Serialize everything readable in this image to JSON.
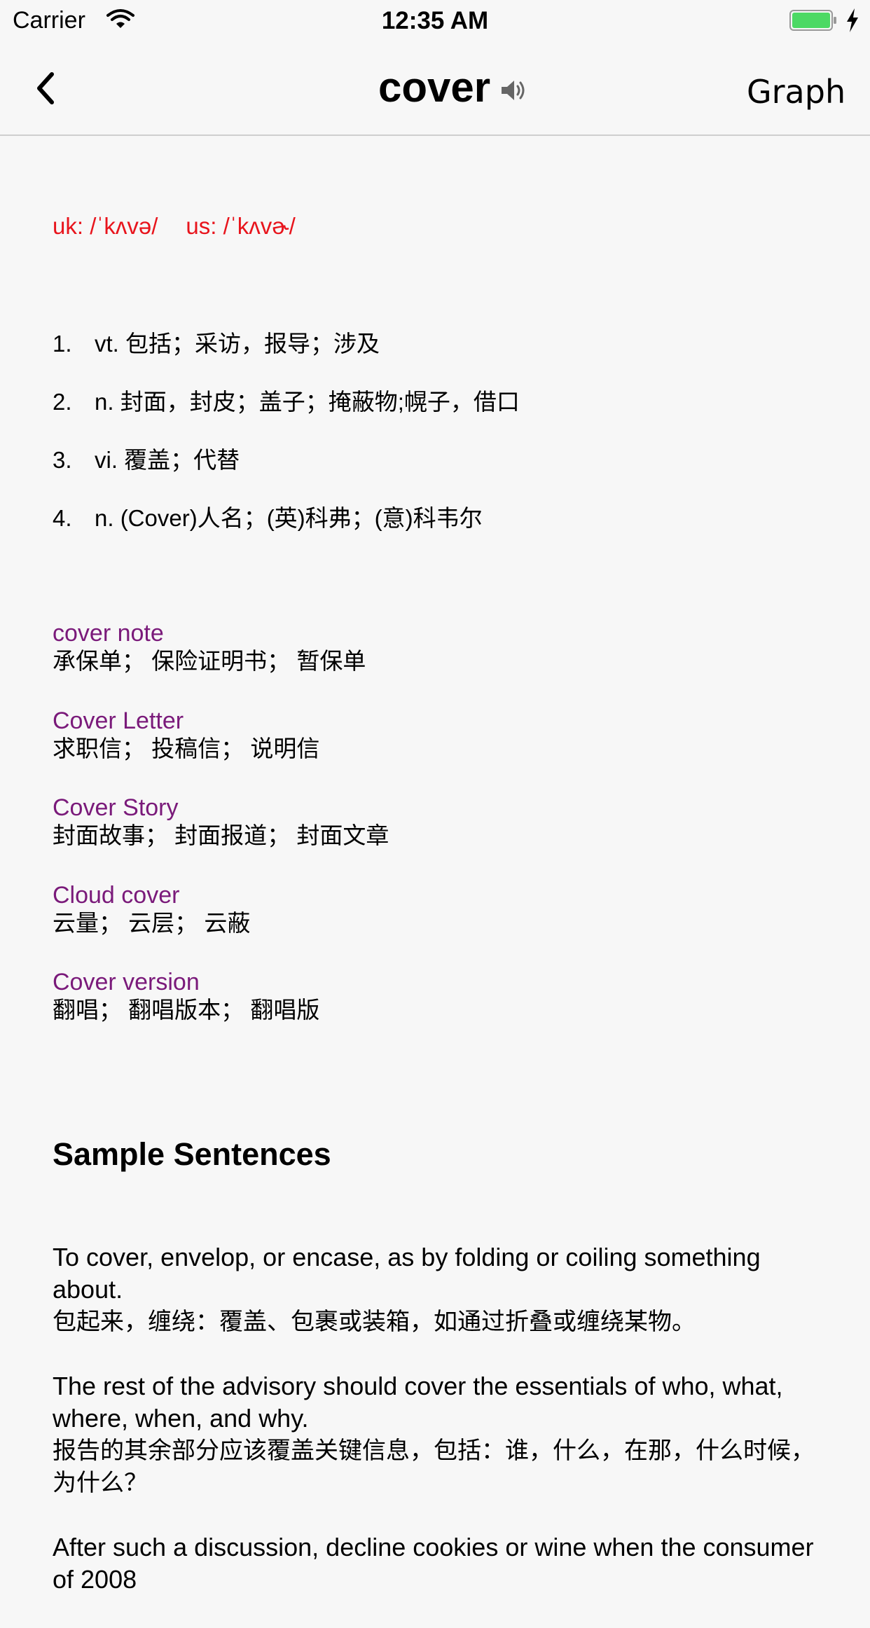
{
  "status_bar": {
    "carrier": "Carrier",
    "time": "12:35 AM",
    "battery_color": "#4cd964"
  },
  "nav": {
    "title": "cover",
    "right_button": "Graph",
    "back_icon": "chevron-left-icon",
    "speaker_icon": "speaker-icon"
  },
  "phonetic": {
    "uk": "uk: /ˈkʌvə/",
    "us": "us: /ˈkʌvɚ/",
    "color": "#e8141c"
  },
  "definitions": [
    {
      "num": "1.",
      "text": "vt. 包括；采访，报导；涉及"
    },
    {
      "num": "2.",
      "text": "n. 封面，封皮；盖子；掩蔽物;幌子，借口"
    },
    {
      "num": "3.",
      "text": "vi. 覆盖；代替"
    },
    {
      "num": "4.",
      "text": "n. (Cover)人名；(英)科弗；(意)科韦尔"
    }
  ],
  "phrases": [
    {
      "title": "cover note",
      "meaning": "承保单；  保险证明书；  暂保单"
    },
    {
      "title": "Cover Letter",
      "meaning": "求职信；  投稿信；  说明信"
    },
    {
      "title": "Cover Story",
      "meaning": "封面故事；  封面报道；  封面文章"
    },
    {
      "title": "Cloud cover",
      "meaning": "云量；  云层；  云蔽"
    },
    {
      "title": "Cover version",
      "meaning": "翻唱；  翻唱版本；  翻唱版"
    }
  ],
  "phrase_color": "#7a1a7a",
  "sample_heading": "Sample Sentences",
  "sentences": [
    {
      "en": "To cover, envelop, or encase, as by folding or coiling something about.",
      "zh": "包起来，缠绕：覆盖、包裹或装箱，如通过折叠或缠绕某物。"
    },
    {
      "en": "The rest of the advisory should cover the essentials of who, what, where, when, and why.",
      "zh": "报告的其余部分应该覆盖关键信息，包括：谁，什么，在那，什么时候，为什么？"
    },
    {
      "en": "After such a discussion, decline cookies or wine when the consumer of 2008",
      "zh": ""
    }
  ]
}
